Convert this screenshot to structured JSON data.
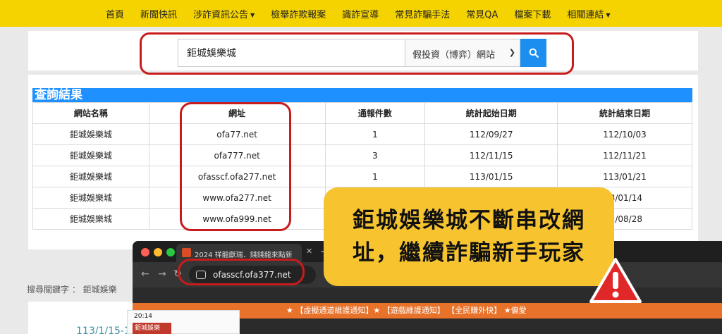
{
  "nav": {
    "items": [
      "首頁",
      "新聞快訊",
      "涉詐資訊公告",
      "檢舉詐欺報案",
      "識詐宣導",
      "常見詐騙手法",
      "常見QA",
      "檔案下載",
      "相關連結"
    ]
  },
  "search": {
    "query": "鉅城娛樂城",
    "category": "假投資（博弈）網站"
  },
  "results": {
    "title": "查詢結果",
    "headers": [
      "網站名稱",
      "網址",
      "通報件數",
      "統計起始日期",
      "統計結束日期"
    ],
    "rows": [
      [
        "鉅城娛樂城",
        "ofa77.net",
        "1",
        "112/09/27",
        "112/10/03"
      ],
      [
        "鉅城娛樂城",
        "ofa777.net",
        "3",
        "112/11/15",
        "112/11/21"
      ],
      [
        "鉅城娛樂城",
        "ofasscf.ofa277.net",
        "1",
        "113/01/15",
        "113/01/21"
      ],
      [
        "鉅城娛樂城",
        "www.ofa277.net",
        "",
        "",
        "3/01/14"
      ],
      [
        "鉅城娛樂城",
        "www.ofa999.net",
        "",
        "",
        "2/08/28"
      ]
    ]
  },
  "keywords": "搜尋關鍵字 ： 鉅城娛樂",
  "date_snippet": "113/1/15-1",
  "browser": {
    "tab_title": "2024 祥龍獻瑞．錢錢龍來點新",
    "url": "ofasscf.ofa377.net",
    "ticker": "★ 【虛擬通道維護通知】★ 【遊戲維護通知】 【全民賺外快】 ★偏愛",
    "phone_time": "20:14",
    "phone_logo": "鉅城娛樂"
  },
  "callout": {
    "line1": "鉅城娛樂城不斷串改網",
    "line2": "址，繼續詐騙新手玩家"
  },
  "colors": {
    "nav_bg": "#f5d300",
    "accent": "#1b8ef0",
    "highlight_ring": "#c81c1c",
    "callout_bg": "#f7c430"
  }
}
